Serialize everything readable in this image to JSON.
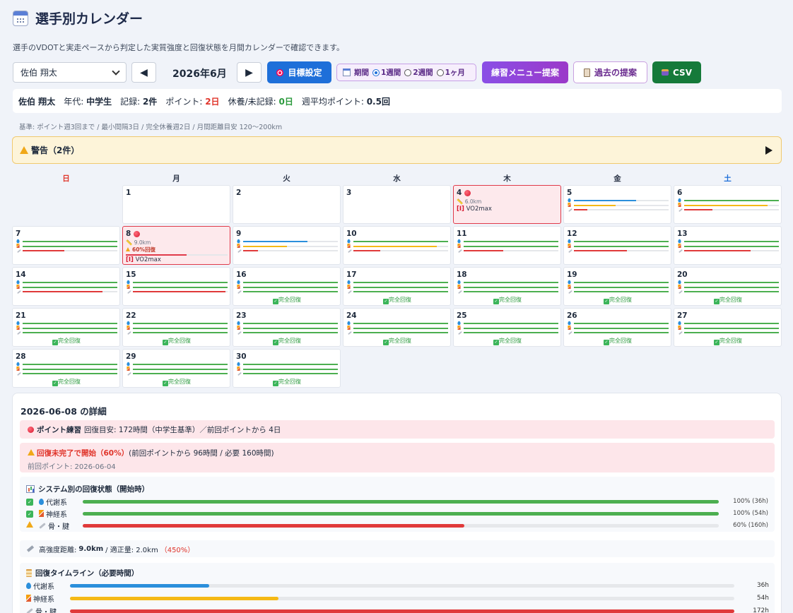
{
  "header": {
    "title": "選手別カレンダー",
    "subtitle": "選手のVDOTと実走ペースから判定した実質強度と回復状態を月間カレンダーで確認できます。"
  },
  "toolbar": {
    "athlete": "佐伯 翔太",
    "prev": "◀",
    "next": "▶",
    "month": "2026年6月",
    "goal_label": "目標設定",
    "period_label": "期間",
    "period_options": [
      "1週間",
      "2週間",
      "1ヶ月"
    ],
    "period_selected": "1週間",
    "menu_label": "練習メニュー提案",
    "past_label": "過去の提案",
    "csv_label": "CSV"
  },
  "summary": {
    "name": "佐伯 翔太",
    "age_label": "年代:",
    "age": "中学生",
    "records_label": "記録:",
    "records": "2件",
    "points_label": "ポイント:",
    "points": "2日",
    "rest_label": "休養/未記録:",
    "rest": "0日",
    "weekly_label": "週平均ポイント:",
    "weekly": "0.5回"
  },
  "criteria": "基準: ポイント週3回まで / 最小間隔3日 / 完全休養週2日 / 月間距離目安 120〜200km",
  "warning": {
    "label": "警告（2件）"
  },
  "weekdays": [
    "日",
    "月",
    "火",
    "水",
    "木",
    "金",
    "土"
  ],
  "colors": {
    "metabolic": "#2b8fdb",
    "nervous": "#f5b916",
    "bone": "#e03a3a",
    "ok": "#4caf50"
  },
  "full_recovery_label": "完全回復",
  "calendar": [
    {
      "day": "1"
    },
    {
      "day": "2"
    },
    {
      "day": "3"
    },
    {
      "day": "4",
      "point": true,
      "distance": "6.0km",
      "menu_tag": "[I]",
      "menu": "VO2max"
    },
    {
      "day": "5",
      "bars": [
        {
          "c": "metabolic",
          "v": 0.66
        },
        {
          "c": "nervous",
          "v": 0.44
        },
        {
          "c": "bone",
          "v": 0.14
        }
      ]
    },
    {
      "day": "6",
      "bars": [
        {
          "c": "ok",
          "v": 1
        },
        {
          "c": "nervous",
          "v": 0.88
        },
        {
          "c": "bone",
          "v": 0.3
        }
      ]
    },
    {
      "day": "7",
      "bars": [
        {
          "c": "ok",
          "v": 1
        },
        {
          "c": "ok",
          "v": 1
        },
        {
          "c": "bone",
          "v": 0.44
        }
      ]
    },
    {
      "day": "8",
      "point": true,
      "distance": "9.0km",
      "warn": "60%回復",
      "menu_tag": "[I]",
      "menu": "VO2max"
    },
    {
      "day": "9",
      "bars": [
        {
          "c": "metabolic",
          "v": 0.68
        },
        {
          "c": "nervous",
          "v": 0.46
        },
        {
          "c": "bone",
          "v": 0.16
        }
      ]
    },
    {
      "day": "10",
      "bars": [
        {
          "c": "ok",
          "v": 1
        },
        {
          "c": "nervous",
          "v": 0.88
        },
        {
          "c": "bone",
          "v": 0.28
        }
      ]
    },
    {
      "day": "11",
      "bars": [
        {
          "c": "ok",
          "v": 1
        },
        {
          "c": "ok",
          "v": 1
        },
        {
          "c": "bone",
          "v": 0.42
        }
      ]
    },
    {
      "day": "12",
      "bars": [
        {
          "c": "ok",
          "v": 1
        },
        {
          "c": "ok",
          "v": 1
        },
        {
          "c": "bone",
          "v": 0.56
        }
      ]
    },
    {
      "day": "13",
      "bars": [
        {
          "c": "ok",
          "v": 1
        },
        {
          "c": "ok",
          "v": 1
        },
        {
          "c": "bone",
          "v": 0.7
        }
      ]
    },
    {
      "day": "14",
      "bars": [
        {
          "c": "ok",
          "v": 1
        },
        {
          "c": "ok",
          "v": 1
        },
        {
          "c": "bone",
          "v": 0.84
        }
      ]
    },
    {
      "day": "15",
      "bars": [
        {
          "c": "ok",
          "v": 1
        },
        {
          "c": "ok",
          "v": 1
        },
        {
          "c": "bone",
          "v": 0.98
        }
      ]
    },
    {
      "day": "16",
      "full": true
    },
    {
      "day": "17",
      "full": true
    },
    {
      "day": "18",
      "full": true
    },
    {
      "day": "19",
      "full": true
    },
    {
      "day": "20",
      "full": true
    },
    {
      "day": "21",
      "full": true
    },
    {
      "day": "22",
      "full": true
    },
    {
      "day": "23",
      "full": true
    },
    {
      "day": "24",
      "full": true
    },
    {
      "day": "25",
      "full": true
    },
    {
      "day": "26",
      "full": true
    },
    {
      "day": "27",
      "full": true
    },
    {
      "day": "28",
      "full": true
    },
    {
      "day": "29",
      "full": true
    },
    {
      "day": "30",
      "full": true
    }
  ],
  "detail": {
    "title": "2026-06-08 の詳細",
    "point_label": "ポイント練習",
    "point_text": "回復目安: 172時間（中学生基準）／前回ポイントから 4日",
    "recovery_warn": "回復未完了で開始（60%）",
    "recovery_text": "(前回ポイントから 96時間 / 必要 160時間)",
    "prev_point": "前回ポイント: 2026-06-04",
    "systems_title": "システム別の回復状態（開始時）",
    "systems": [
      {
        "name": "代謝系",
        "icon": "drop",
        "status": "ok",
        "value": 1.0,
        "label": "100% (36h)",
        "color": "#4caf50"
      },
      {
        "name": "神経系",
        "icon": "bolt",
        "status": "ok",
        "value": 1.0,
        "label": "100% (54h)",
        "color": "#4caf50"
      },
      {
        "name": "骨・腱",
        "icon": "bone",
        "status": "warn",
        "value": 0.6,
        "label": "60% (160h)",
        "color": "#e03a3a"
      }
    ],
    "hi_label": "高強度距離:",
    "hi_value": "9.0km",
    "hi_mid": "/ 適正量: 2.0km",
    "hi_pct": "（450%）",
    "timeline_title": "回復タイムライン（必要時間）",
    "timeline": [
      {
        "name": "代謝系",
        "icon": "drop",
        "hours": 36,
        "label": "36h",
        "color": "#2b8fdb"
      },
      {
        "name": "神経系",
        "icon": "bolt",
        "hours": 54,
        "label": "54h",
        "color": "#f5b916"
      },
      {
        "name": "骨・腱",
        "icon": "bone",
        "hours": 172,
        "label": "172h",
        "color": "#e03a3a"
      }
    ],
    "timeline_max": 172
  }
}
